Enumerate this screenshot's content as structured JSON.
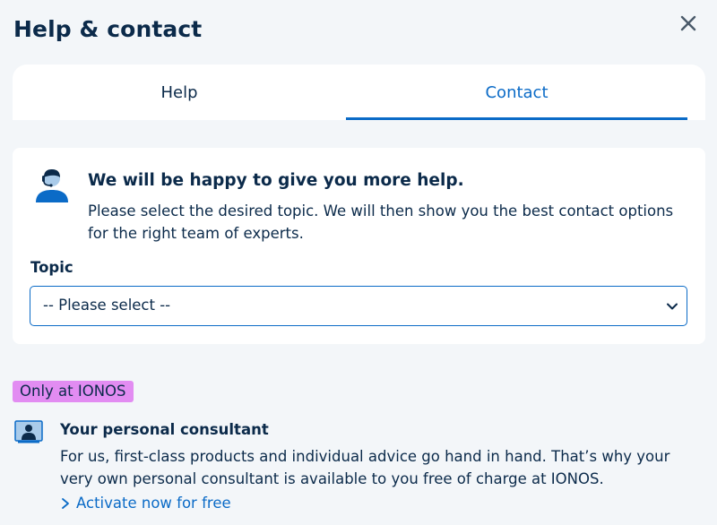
{
  "header": {
    "title": "Help & contact",
    "close_icon": "close-icon"
  },
  "tabs": [
    {
      "label": "Help",
      "active": false
    },
    {
      "label": "Contact",
      "active": true
    }
  ],
  "contact_card": {
    "icon": "support-agent-icon",
    "heading": "We will be happy to give you more help.",
    "text": "Please select the desired topic. We will then show you the best contact options for the right team of experts.",
    "topic_label": "Topic",
    "topic_select": {
      "selected": "-- Please select --",
      "icon": "chevron-down-icon"
    }
  },
  "promo": {
    "badge": "Only at IONOS",
    "icon": "consultant-monitor-icon",
    "heading": "Your personal consultant",
    "text": "For us, first-class products and individual advice go hand in hand. That’s why your very own personal consultant is available to you free of charge at IONOS.",
    "link": "Activate now for free"
  },
  "colors": {
    "accent": "#0b6bc7",
    "text": "#0b2a4a",
    "background": "#f3f6f9",
    "badge": "#e28cf2"
  }
}
